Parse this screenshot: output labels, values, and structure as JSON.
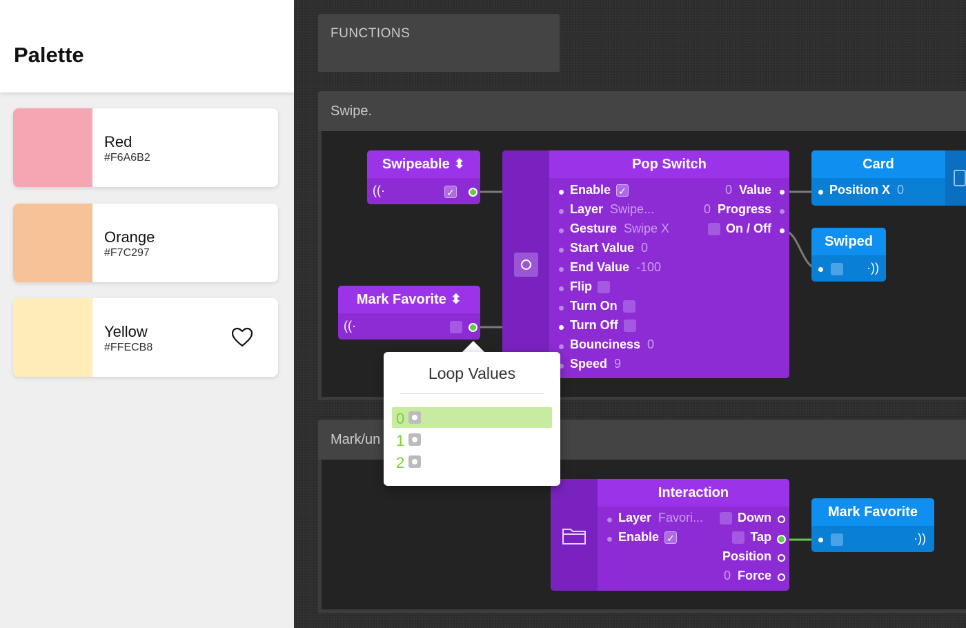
{
  "preview": {
    "title": "Palette",
    "swatches": [
      {
        "name": "Red",
        "hex": "#F6A6B2",
        "color": "#F6A6B2"
      },
      {
        "name": "Orange",
        "hex": "#F7C297",
        "color": "#F7C297"
      },
      {
        "name": "Yellow",
        "hex": "#FFECB8",
        "color": "#FFECB8"
      }
    ]
  },
  "canvas": {
    "functions_label": "FUNCTIONS",
    "groups": [
      {
        "label": "Swipe."
      },
      {
        "label": "Mark/un"
      }
    ],
    "patches": {
      "swipeable": {
        "title": "Swipeable ⬍"
      },
      "mark_favorite_source": {
        "title": "Mark Favorite ⬍"
      },
      "pop_switch": {
        "title": "Pop Switch",
        "inputs": [
          {
            "label": "Enable",
            "value": ""
          },
          {
            "label": "Layer",
            "value": "Swipe..."
          },
          {
            "label": "Gesture",
            "value": "Swipe X"
          },
          {
            "label": "Start Value",
            "value": "0"
          },
          {
            "label": "End Value",
            "value": "-100"
          },
          {
            "label": "Flip",
            "value": ""
          },
          {
            "label": "Turn On",
            "value": ""
          },
          {
            "label": "Turn Off",
            "value": ""
          },
          {
            "label": "Bounciness",
            "value": "0"
          },
          {
            "label": "Speed",
            "value": "9"
          }
        ],
        "outputs": [
          {
            "label": "Value",
            "value": "0"
          },
          {
            "label": "Progress",
            "value": "0"
          },
          {
            "label": "On / Off",
            "value": ""
          }
        ]
      },
      "card": {
        "title": "Card",
        "input_label": "Position X",
        "input_value": "0"
      },
      "swiped": {
        "title": "Swiped"
      },
      "interaction": {
        "title": "Interaction",
        "inputs": [
          {
            "label": "Layer",
            "value": "Favori..."
          },
          {
            "label": "Enable",
            "value": ""
          }
        ],
        "outputs": [
          {
            "label": "Down",
            "value": ""
          },
          {
            "label": "Tap",
            "value": ""
          },
          {
            "label": "Position",
            "value": ""
          },
          {
            "label": "Force",
            "value": "0"
          }
        ]
      },
      "mark_favorite_target": {
        "title": "Mark Favorite"
      }
    }
  },
  "popover": {
    "title": "Loop Values",
    "items": [
      "0",
      "1",
      "2"
    ],
    "selected_index": 0
  },
  "colors": {
    "patch_purple": "#8d2bd4",
    "patch_blue": "#0a7fd6",
    "wire_green": "#62c84a",
    "selection_green": "#c8ec9f"
  }
}
